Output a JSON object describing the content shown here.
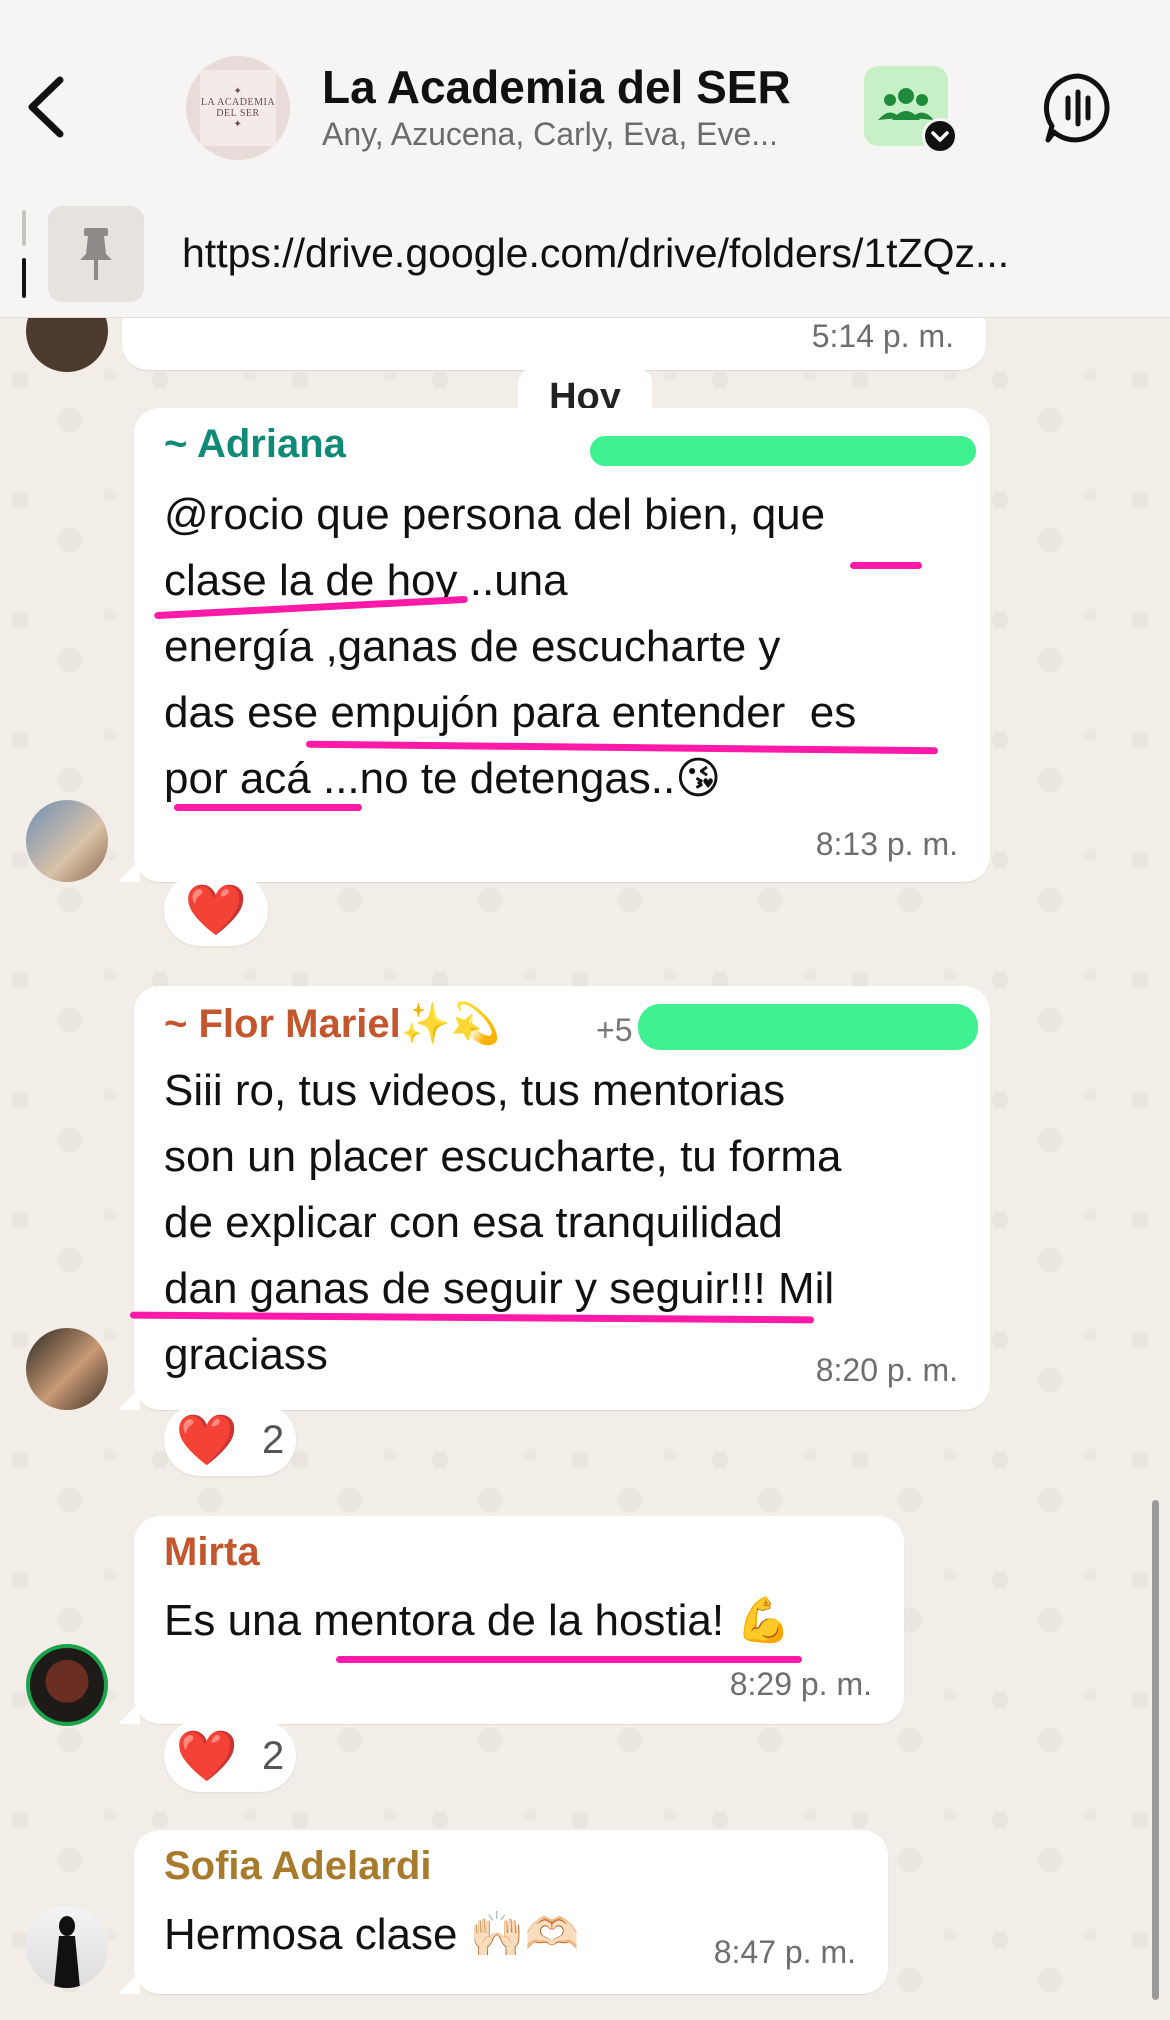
{
  "header": {
    "title": "La Academia del SER",
    "subtitle": "Any, Azucena, Carly, Eva, Eve...",
    "avatar_text": "LA ACADEMIA DEL SER",
    "pinned_url": "https://drive.google.com/drive/folders/1tZQz..."
  },
  "top_partial": {
    "time": "5:14 p. m."
  },
  "day_divider": "Hoy",
  "messages": [
    {
      "sender": "~ Adriana",
      "sender_color": "#0f8a76",
      "text": "@rocio que persona del bien, que\nclase la de hoy ..una\nenergía ,ganas de escucharte y\ndas ese empujón para entender  es\npor acá ...no te detengas..😘",
      "time": "8:13 p. m.",
      "reaction": "❤️"
    },
    {
      "sender": "~ Flor Mariel✨💫",
      "sender_color": "#c4562e",
      "phone_prefix": "+5",
      "text": "Siii ro, tus videos, tus mentorias\nson un placer escucharte, tu forma\nde explicar con esa tranquilidad\ndan ganas de seguir y seguir!!! Mil\ngraciass",
      "time": "8:20 p. m.",
      "reaction": "❤️",
      "reaction_count": "2"
    },
    {
      "sender": "Mirta",
      "sender_color": "#c4562e",
      "text": "Es una mentora de la hostia! 💪",
      "time": "8:29 p. m.",
      "reaction": "❤️",
      "reaction_count": "2"
    },
    {
      "sender": "Sofia Adelardi",
      "sender_color": "#a87a2c",
      "text": "Hermosa clase 🙌🏻🫶🏻",
      "time": "8:47 p. m."
    }
  ],
  "colors": {
    "highlight": "#3ef08f",
    "underline": "#ff1aa8",
    "header_bg": "#f6f5f3"
  },
  "icons": [
    "back-chevron-icon",
    "community-icon",
    "voice-chat-icon",
    "pin-icon"
  ]
}
